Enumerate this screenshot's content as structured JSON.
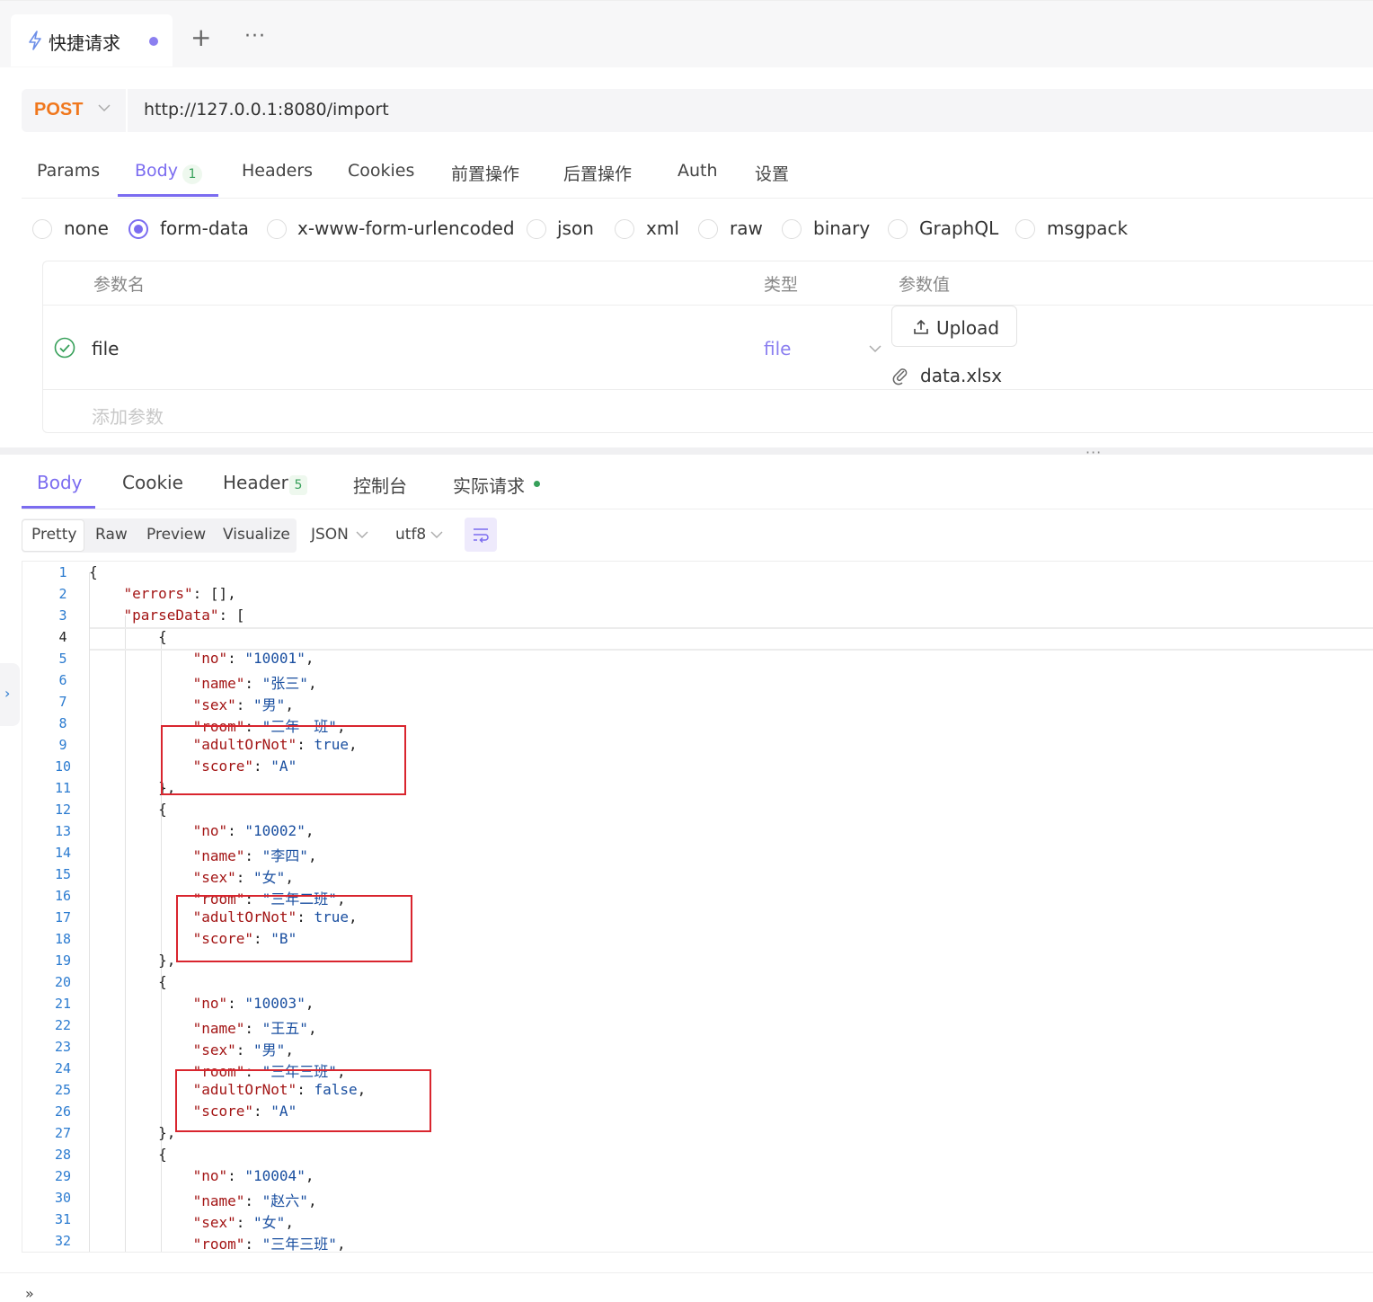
{
  "tab": {
    "title": "快捷请求",
    "icon": "bolt-icon",
    "unsaved_dot_color": "#8b7ff0"
  },
  "tabbar": {
    "add_label": "+",
    "more_label": "···"
  },
  "request": {
    "method": "POST",
    "url": "http://127.0.0.1:8080/import"
  },
  "request_tabs": [
    {
      "label": "Params"
    },
    {
      "label": "Body",
      "badge": "1",
      "active": true
    },
    {
      "label": "Headers"
    },
    {
      "label": "Cookies"
    },
    {
      "label": "前置操作"
    },
    {
      "label": "后置操作"
    },
    {
      "label": "Auth"
    },
    {
      "label": "设置"
    }
  ],
  "body_types": [
    {
      "label": "none"
    },
    {
      "label": "form-data",
      "selected": true
    },
    {
      "label": "x-www-form-urlencoded"
    },
    {
      "label": "json"
    },
    {
      "label": "xml"
    },
    {
      "label": "raw"
    },
    {
      "label": "binary"
    },
    {
      "label": "GraphQL"
    },
    {
      "label": "msgpack"
    }
  ],
  "form_table": {
    "headers": {
      "name": "参数名",
      "type": "类型",
      "value": "参数值"
    },
    "rows": [
      {
        "name": "file",
        "type": "file",
        "upload_label": "Upload",
        "file_name": "data.xlsx",
        "enabled": true
      }
    ],
    "add_placeholder": "添加参数"
  },
  "splitter": {
    "label": "···"
  },
  "response_tabs": [
    {
      "label": "Body",
      "active": true
    },
    {
      "label": "Cookie"
    },
    {
      "label": "Header",
      "badge": "5"
    },
    {
      "label": "控制台"
    },
    {
      "label": "实际请求",
      "status_dot": true
    }
  ],
  "view_modes": [
    {
      "label": "Pretty",
      "active": true
    },
    {
      "label": "Raw"
    },
    {
      "label": "Preview"
    },
    {
      "label": "Visualize"
    }
  ],
  "format": {
    "label": "JSON"
  },
  "encoding": {
    "label": "utf8"
  },
  "colors": {
    "accent": "#7b6cf0",
    "method": "#f0771d",
    "success": "#37a05a",
    "highlight": "#d9252e"
  },
  "code_lines": [
    {
      "n": "1",
      "t": "{"
    },
    {
      "n": "2",
      "t": "    \"errors\": [],"
    },
    {
      "n": "3",
      "t": "    \"parseData\": ["
    },
    {
      "n": "4",
      "t": "        {"
    },
    {
      "n": "5",
      "t": "            \"no\": \"10001\","
    },
    {
      "n": "6",
      "t": "            \"name\": \"张三\","
    },
    {
      "n": "7",
      "t": "            \"sex\": \"男\","
    },
    {
      "n": "8",
      "t": "            \"room\": \"三年一班\","
    },
    {
      "n": "9",
      "t": "            \"adultOrNot\": true,"
    },
    {
      "n": "10",
      "t": "            \"score\": \"A\""
    },
    {
      "n": "11",
      "t": "        },"
    },
    {
      "n": "12",
      "t": "        {"
    },
    {
      "n": "13",
      "t": "            \"no\": \"10002\","
    },
    {
      "n": "14",
      "t": "            \"name\": \"李四\","
    },
    {
      "n": "15",
      "t": "            \"sex\": \"女\","
    },
    {
      "n": "16",
      "t": "            \"room\": \"三年二班\","
    },
    {
      "n": "17",
      "t": "            \"adultOrNot\": true,"
    },
    {
      "n": "18",
      "t": "            \"score\": \"B\""
    },
    {
      "n": "19",
      "t": "        },"
    },
    {
      "n": "20",
      "t": "        {"
    },
    {
      "n": "21",
      "t": "            \"no\": \"10003\","
    },
    {
      "n": "22",
      "t": "            \"name\": \"王五\","
    },
    {
      "n": "23",
      "t": "            \"sex\": \"男\","
    },
    {
      "n": "24",
      "t": "            \"room\": \"三年三班\","
    },
    {
      "n": "25",
      "t": "            \"adultOrNot\": false,"
    },
    {
      "n": "26",
      "t": "            \"score\": \"A\""
    },
    {
      "n": "27",
      "t": "        },"
    },
    {
      "n": "28",
      "t": "        {"
    },
    {
      "n": "29",
      "t": "            \"no\": \"10004\","
    },
    {
      "n": "30",
      "t": "            \"name\": \"赵六\","
    },
    {
      "n": "31",
      "t": "            \"sex\": \"女\","
    },
    {
      "n": "32",
      "t": "            \"room\": \"三年三班\","
    }
  ],
  "current_line": "4",
  "side_toggle": {
    "label": "›"
  },
  "bottom": {
    "label": "»"
  }
}
